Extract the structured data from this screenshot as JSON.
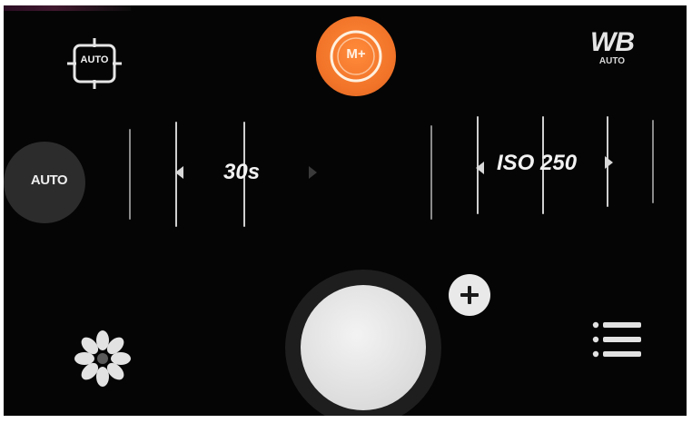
{
  "focus_mode": {
    "label": "AUTO",
    "icon": "focus-frame-icon"
  },
  "camera_mode": {
    "label": "M+",
    "icon": "aperture-icon",
    "accent_color": "#f2752a"
  },
  "white_balance": {
    "main": "WB",
    "sub": "AUTO"
  },
  "exposure_auto": {
    "label": "AUTO"
  },
  "shutter_speed": {
    "value": "30s"
  },
  "iso": {
    "value": "ISO 250"
  },
  "controls": {
    "shutter_icon": "shutter-button",
    "add_icon": "plus-icon",
    "filter_icon": "flower-icon",
    "menu_icon": "list-icon"
  }
}
